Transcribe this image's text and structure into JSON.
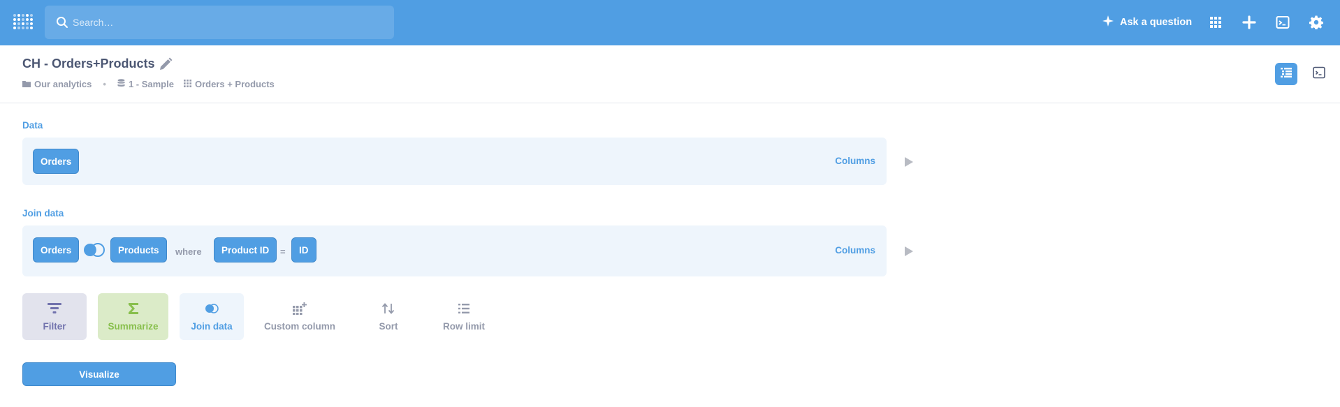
{
  "topbar": {
    "search_placeholder": "Search…",
    "ask_label": "Ask a question",
    "bg_color": "#509ee3"
  },
  "header": {
    "title": "CH - Orders+Products",
    "breadcrumbs": [
      {
        "icon": "folder-icon",
        "label": "Our analytics"
      },
      {
        "icon": "database-icon",
        "label": "1 - Sample"
      },
      {
        "icon": "grid-icon",
        "label": "Orders + Products"
      }
    ]
  },
  "data_step": {
    "label": "Data",
    "table": "Orders",
    "columns_label": "Columns"
  },
  "join_step": {
    "label": "Join data",
    "left_table": "Orders",
    "right_table": "Products",
    "where_label": "where",
    "left_column": "Product ID",
    "operator": "=",
    "right_column": "ID",
    "columns_label": "Columns"
  },
  "actions": [
    {
      "label": "Filter",
      "icon": "filter-icon",
      "color": "#7172ad"
    },
    {
      "label": "Summarize",
      "icon": "sigma-icon",
      "color": "#88bf4d"
    },
    {
      "label": "Join data",
      "icon": "join-icon",
      "color": "#509ee3"
    },
    {
      "label": "Custom column",
      "icon": "add-column-icon",
      "color": "#949aab"
    },
    {
      "label": "Sort",
      "icon": "sort-icon",
      "color": "#949aab"
    },
    {
      "label": "Row limit",
      "icon": "list-icon",
      "color": "#949aab"
    }
  ],
  "visualize_label": "Visualize"
}
